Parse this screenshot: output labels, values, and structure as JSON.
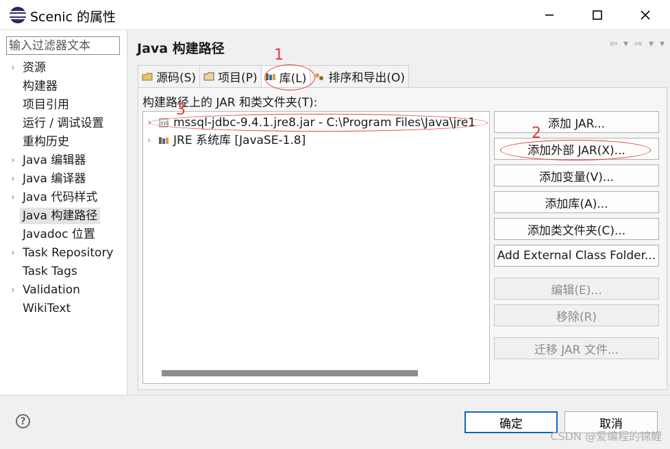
{
  "window": {
    "title": "Scenic 的属性",
    "minimize_icon": "minimize-icon",
    "maximize_icon": "maximize-icon",
    "close_icon": "close-icon"
  },
  "sidebar": {
    "filter_placeholder": "输入过滤器文本",
    "items": [
      {
        "label": "资源",
        "expandable": true
      },
      {
        "label": "构建器",
        "expandable": false
      },
      {
        "label": "项目引用",
        "expandable": false
      },
      {
        "label": "运行 / 调试设置",
        "expandable": false
      },
      {
        "label": "重构历史",
        "expandable": false
      },
      {
        "label": "Java 编辑器",
        "expandable": true
      },
      {
        "label": "Java 编译器",
        "expandable": true
      },
      {
        "label": "Java 代码样式",
        "expandable": true
      },
      {
        "label": "Java 构建路径",
        "expandable": false,
        "selected": true
      },
      {
        "label": "Javadoc 位置",
        "expandable": false
      },
      {
        "label": "Task Repository",
        "expandable": true
      },
      {
        "label": "Task Tags",
        "expandable": false
      },
      {
        "label": "Validation",
        "expandable": true
      },
      {
        "label": "WikiText",
        "expandable": false
      }
    ]
  },
  "main": {
    "title": "Java 构建路径",
    "tabs": [
      {
        "label": "源码(S)",
        "icon": "source-folder-icon"
      },
      {
        "label": "项目(P)",
        "icon": "project-folder-icon"
      },
      {
        "label": "库(L)",
        "icon": "library-icon",
        "active": true
      },
      {
        "label": "排序和导出(O)",
        "icon": "order-export-icon"
      }
    ],
    "list_label": "构建路径上的 JAR 和类文件夹(T):",
    "entries": [
      {
        "text": "mssql-jdbc-9.4.1.jre8.jar  -  C:\\Program Files\\Java\\jre1",
        "icon": "jar-icon"
      },
      {
        "text": "JRE 系统库 [JavaSE-1.8]",
        "icon": "library-icon"
      }
    ],
    "buttons": [
      {
        "label": "添加 JAR...",
        "enabled": true
      },
      {
        "label": "添加外部 JAR(X)...",
        "enabled": true
      },
      {
        "label": "添加变量(V)...",
        "enabled": true
      },
      {
        "label": "添加库(A)...",
        "enabled": true
      },
      {
        "label": "添加类文件夹(C)...",
        "enabled": true
      },
      {
        "label": "Add External Class Folder...",
        "enabled": true
      },
      {
        "label": "编辑(E)...",
        "enabled": false
      },
      {
        "label": "移除(R)",
        "enabled": false
      },
      {
        "label": "迁移 JAR 文件...",
        "enabled": false
      }
    ]
  },
  "annotations": {
    "one": "1",
    "two": "2",
    "three": "3",
    "color": "#e53935"
  },
  "footer": {
    "ok": "确定",
    "cancel": "取消",
    "help_icon": "help-icon"
  },
  "watermark": "CSDN @爱编程的锦鲤"
}
